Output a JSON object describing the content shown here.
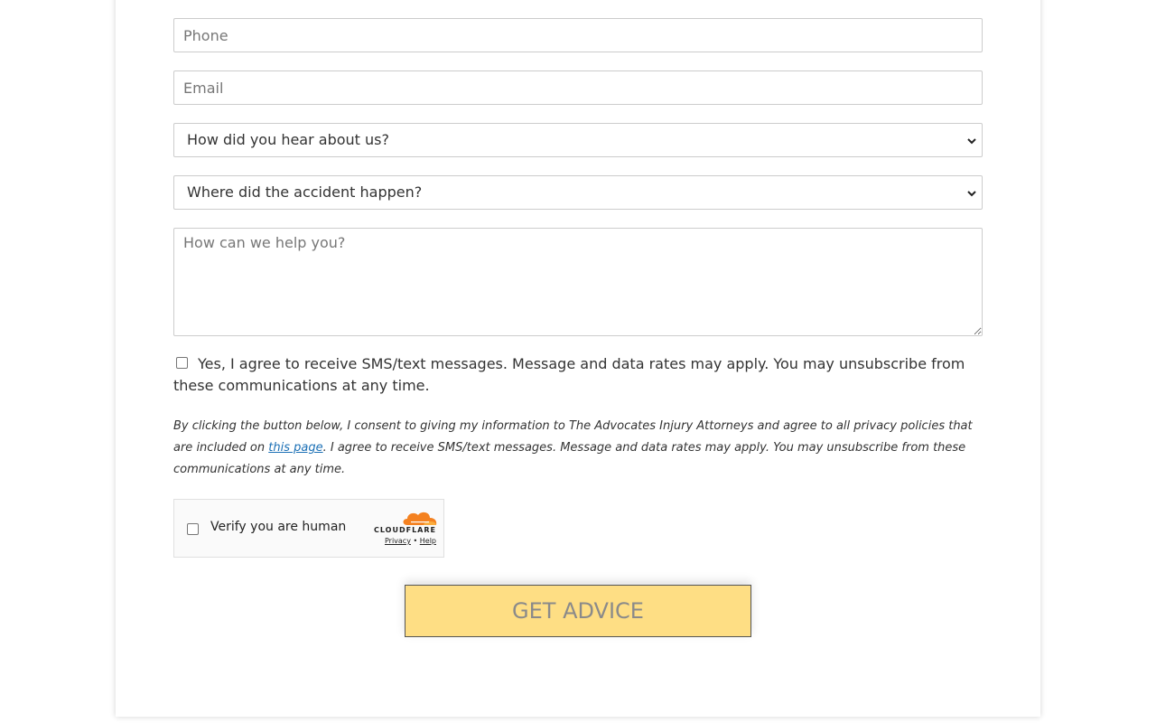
{
  "form": {
    "phone_placeholder": "Phone",
    "email_placeholder": "Email",
    "hear_select_value": "How did you hear about us?",
    "accident_select_value": "Where did the accident happen?",
    "help_placeholder": "How can we help you?",
    "sms_consent_label": "Yes, I agree to receive SMS/text messages. Message and data rates may apply. You may unsubscribe from these communications at any time.",
    "consent_before_link": "By clicking the button below, I consent to giving my information to The Advocates Injury Attorneys and agree to all privacy policies that are included on ",
    "consent_link_text": "this page",
    "consent_after_link": ". I agree to receive SMS/text messages. Message and data rates may apply. You may unsubscribe from these communications at any time.",
    "submit_label": "GET ADVICE"
  },
  "captcha": {
    "label": "Verify you are human",
    "brand": "CLOUDFLARE",
    "privacy_link": "Privacy",
    "separator": "•",
    "help_link": "Help",
    "logo_icon": "cloudflare-cloud-icon"
  },
  "colors": {
    "button_bg": "#fede84",
    "button_text": "#8a8a8a",
    "link": "#1a6fb5",
    "cloudflare_orange": "#f48120"
  }
}
